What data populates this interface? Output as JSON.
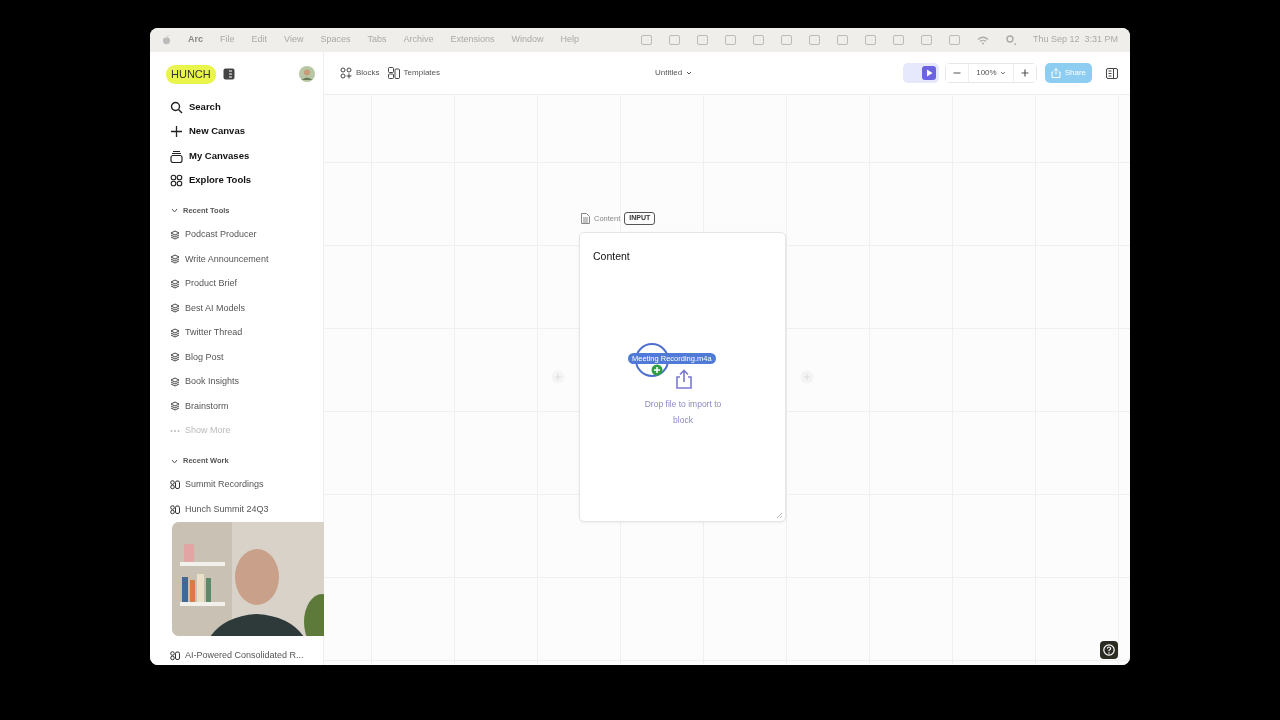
{
  "menubar": {
    "app": "Arc",
    "menus": [
      "File",
      "Edit",
      "View",
      "Spaces",
      "Tabs",
      "Archive",
      "Extensions",
      "Window",
      "Help"
    ],
    "date": "Thu Sep 12",
    "time": "3:31 PM"
  },
  "sidebar": {
    "logo": "HUNCH",
    "nav": [
      {
        "label": "Search",
        "kind": "search"
      },
      {
        "label": "New Canvas",
        "kind": "plus"
      },
      {
        "label": "My Canvases",
        "kind": "stack"
      },
      {
        "label": "Explore Tools",
        "kind": "grid"
      }
    ],
    "sections": [
      {
        "title": "Recent Tools",
        "expanded": true,
        "kind": "tools",
        "items": [
          "Podcast Producer",
          "Write Announcement",
          "Product Brief",
          "Best AI Models",
          "Twitter Thread",
          "Blog Post",
          "Book Insights",
          "Brainstorm"
        ],
        "more": "Show More"
      },
      {
        "title": "Recent Work",
        "expanded": true,
        "kind": "work",
        "items": [
          "Summit Recordings",
          "Hunch Summit 24Q3"
        ],
        "last_item": "AI-Powered Consolidated R..."
      }
    ]
  },
  "toolbar": {
    "left": [
      {
        "label": "Blocks",
        "kind": "blocks"
      },
      {
        "label": "Templates",
        "kind": "templates"
      }
    ],
    "doc_title": "Untitled",
    "zoom": "100%",
    "share": "Share"
  },
  "node": {
    "label": "Content",
    "badge": "INPUT",
    "title": "Content",
    "drop_text": "Drop file to import to block",
    "dragged_file": "Meeting Recording.m4a"
  }
}
